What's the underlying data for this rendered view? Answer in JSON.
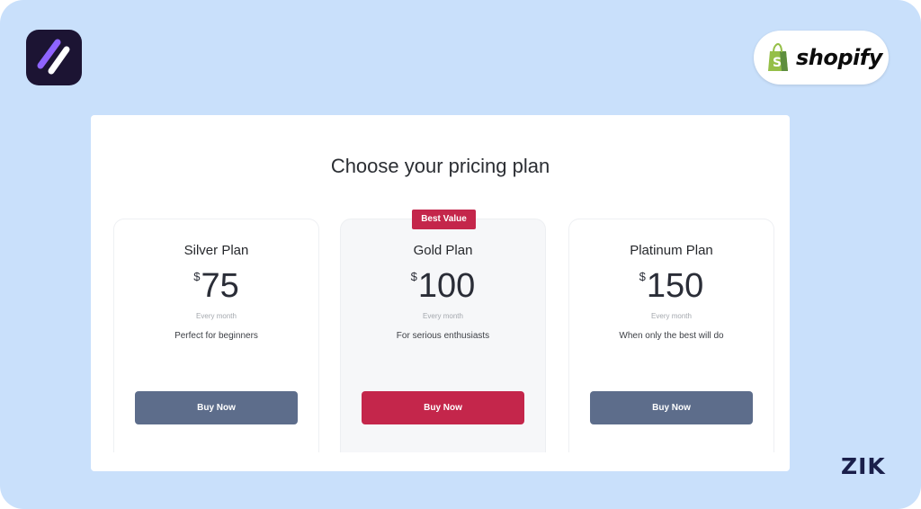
{
  "brand": {
    "app_logo_icon": "slash-stripes-icon",
    "shopify_text": "shopify",
    "shopify_icon": "shopify-bag-icon",
    "watermark": "ZIK"
  },
  "pricing": {
    "title": "Choose your pricing plan",
    "badge": "Best Value",
    "plans": [
      {
        "name": "Silver Plan",
        "currency": "$",
        "price": "75",
        "period": "Every month",
        "tagline": "Perfect for beginners",
        "button": "Buy Now"
      },
      {
        "name": "Gold Plan",
        "currency": "$",
        "price": "100",
        "period": "Every month",
        "tagline": "For serious enthusiasts",
        "button": "Buy Now"
      },
      {
        "name": "Platinum Plan",
        "currency": "$",
        "price": "150",
        "period": "Every month",
        "tagline": "When only the best will do",
        "button": "Buy Now"
      }
    ]
  },
  "colors": {
    "background": "#c9e0fb",
    "accent": "#c4264b",
    "button_default": "#5d6d8b",
    "shopify_green": "#95bf47"
  }
}
